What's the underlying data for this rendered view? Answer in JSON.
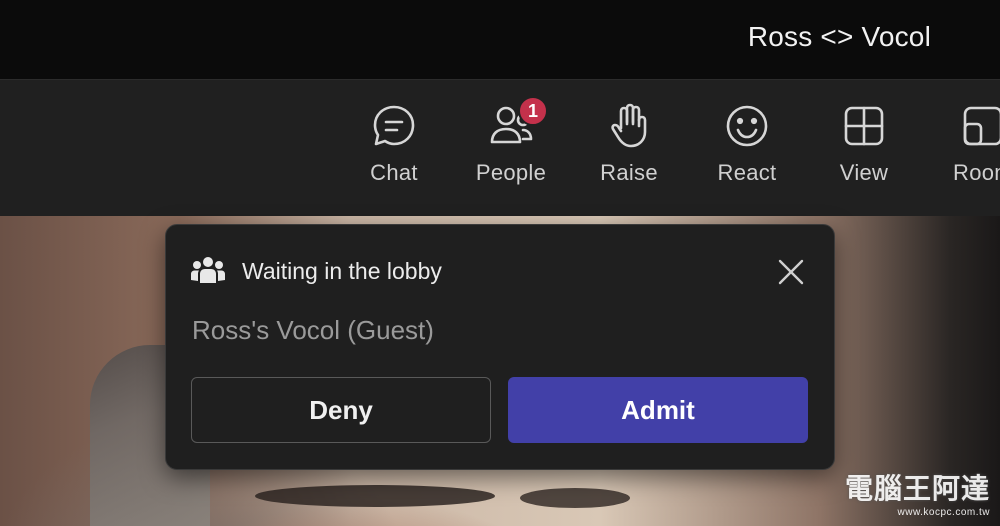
{
  "window": {
    "title": "Ross <> Vocol"
  },
  "toolbar": {
    "items": [
      {
        "label": "Chat",
        "icon": "chat-icon"
      },
      {
        "label": "People",
        "icon": "people-icon",
        "badge": "1"
      },
      {
        "label": "Raise",
        "icon": "raise-hand-icon"
      },
      {
        "label": "React",
        "icon": "react-smiley-icon"
      },
      {
        "label": "View",
        "icon": "view-grid-icon"
      },
      {
        "label": "Room",
        "icon": "rooms-icon"
      }
    ]
  },
  "lobby": {
    "heading": "Waiting in the lobby",
    "icon": "group-icon",
    "guest_name": "Ross's Vocol (Guest)",
    "deny_label": "Deny",
    "admit_label": "Admit"
  },
  "watermark": {
    "text": "電腦王阿達",
    "url": "www.kocpc.com.tw"
  },
  "colors": {
    "accent": "#4240a8",
    "badge": "#c4314b",
    "toolbar_bg": "#202020",
    "card_bg": "#1f1f1f"
  }
}
